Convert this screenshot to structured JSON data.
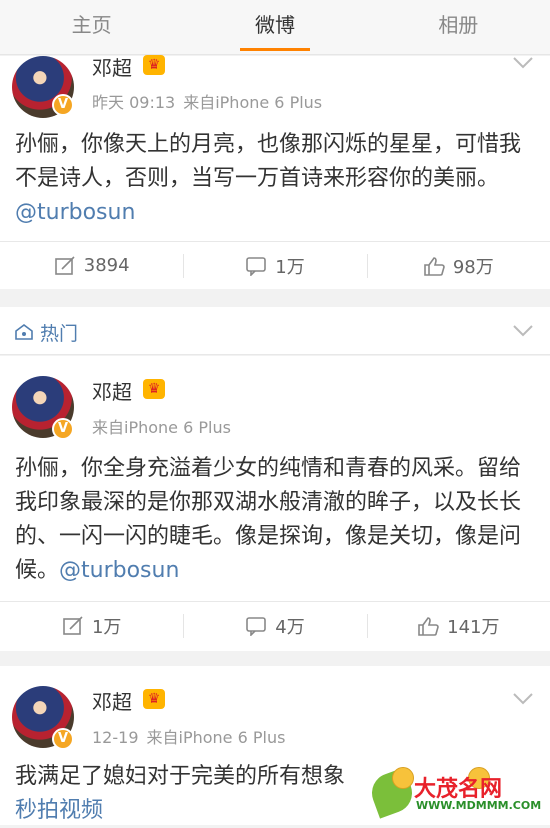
{
  "tabs": [
    {
      "label": "主页"
    },
    {
      "label": "微博"
    },
    {
      "label": "相册"
    }
  ],
  "posts": [
    {
      "author": "邓超",
      "time": "昨天 09:13",
      "source": "来自iPhone 6 Plus",
      "text": "孙俪，你像天上的月亮，也像那闪烁的星星，可惜我不是诗人，否则，当写一万首诗来形容你的美丽。",
      "mention": "@turbosun",
      "reposts": "3894",
      "comments": "1万",
      "likes": "98万"
    },
    {
      "author": "邓超",
      "time": "",
      "source": "来自iPhone 6 Plus",
      "text": "孙俪，你全身充溢着少女的纯情和青春的风采。留给我印象最深的是你那双湖水般清澈的眸子，以及长长的、一闪一闪的睫毛。像是探询，像是关切，像是问候。",
      "mention": "@turbosun",
      "reposts": "1万",
      "comments": "4万",
      "likes": "141万"
    },
    {
      "author": "邓超",
      "time": "12-19",
      "source": "来自iPhone 6 Plus",
      "text": "我满足了媳妇对于完美的所有想象",
      "link": "秒拍视频"
    }
  ],
  "hot": {
    "label": "热门"
  },
  "verified_badge": "V",
  "crown_glyph": "♛",
  "watermark": {
    "title": "大茂名网",
    "url": "WWW.MDMMM.COM"
  },
  "colors": {
    "accent": "#ff8200",
    "link": "#507daf",
    "verified": "#f5a623"
  }
}
